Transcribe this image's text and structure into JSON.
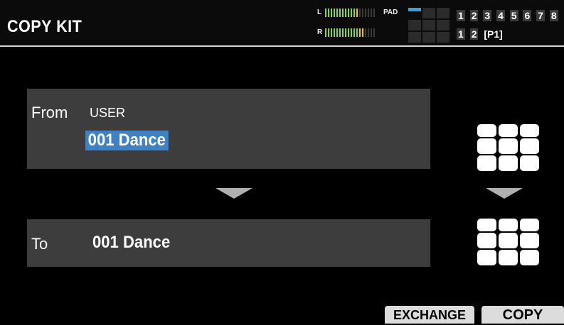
{
  "screen": {
    "title": "COPY KIT"
  },
  "meters": {
    "left_label": "L",
    "right_label": "R",
    "pad_label": "PAD"
  },
  "kit_numbers": [
    "1",
    "2",
    "3",
    "4",
    "5",
    "6",
    "7",
    "8"
  ],
  "page_numbers": [
    "1",
    "2"
  ],
  "page_indicator": "[P1]",
  "from": {
    "label": "From",
    "bank": "USER",
    "kit": "001 Dance"
  },
  "to": {
    "label": "To",
    "kit": "001 Dance"
  },
  "buttons": {
    "exchange": "EXCHANGE",
    "copy": "COPY"
  },
  "colors": {
    "selection": "#3d82c4",
    "panel": "#3d3d3d",
    "meter_green": "#8bd34a",
    "meter_yellow": "#f2c21b",
    "pad_active": "#3aa0e0"
  }
}
